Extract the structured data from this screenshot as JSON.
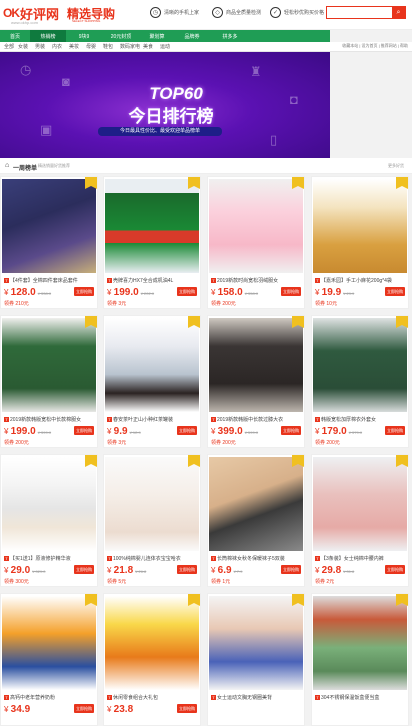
{
  "header": {
    "logo_ok": "OK",
    "logo_text": "好评网",
    "logo_sub": "www.okhp.com",
    "slogan": "精选导购",
    "slogan_sub": "SELECT SHOPPING",
    "features": [
      {
        "icon": "clock-icon",
        "label": "清晰的手机上家"
      },
      {
        "icon": "shield-icon",
        "label": "商品全质量检测"
      },
      {
        "icon": "check-icon",
        "label": "轻松秒优购买价格"
      }
    ],
    "search_placeholder": "",
    "search_icon": "search-icon"
  },
  "nav": {
    "items": [
      "首页",
      "热销榜",
      "9块9",
      "20元封顶",
      "聚划算",
      "品牌券",
      "拼多多"
    ]
  },
  "categories": {
    "items": [
      "全部",
      "女装",
      "男装",
      "内衣",
      "美妆",
      "母婴",
      "鞋包",
      "数码家电",
      "美食",
      "运动"
    ],
    "right_links": "收藏本站 | 设为首页 | 推荐网站 | 帮助"
  },
  "banner": {
    "title": "TOP60",
    "main": "今日排行榜",
    "sub": "今日最具性价比、最受欢迎单品榜单"
  },
  "section": {
    "title": "一周榜单",
    "sub": "精选销量好货推荐",
    "more": "更多好货"
  },
  "products": [
    {
      "name": "【4件套】全棉四件套床品套件",
      "price": "128.0",
      "orig": "¥ 338.0",
      "coupon": "领券 210元"
    },
    {
      "name": "壳牌喜力HX7全合成机油4L",
      "price": "199.0",
      "orig": "¥ 202.0",
      "coupon": "领券 3元"
    },
    {
      "name": "2019新款时尚宽松羽绒服女",
      "price": "158.0",
      "orig": "¥ 358.0",
      "coupon": "领券 200元"
    },
    {
      "name": "【嘉禾园】手工小麻花200g*4袋",
      "price": "19.9",
      "orig": "¥ 29.9",
      "coupon": "领券 10元"
    },
    {
      "name": "2019新款韩版宽松中长款棉服女",
      "price": "199.0",
      "orig": "¥ 399.0",
      "coupon": "领券 200元"
    },
    {
      "name": "春安茶叶正山小种红茶罐装",
      "price": "9.9",
      "orig": "¥ 12.9",
      "coupon": "领券 3元"
    },
    {
      "name": "2019新款韩版中长款过膝大衣",
      "price": "399.0",
      "orig": "¥ 599.0",
      "coupon": "领券 200元"
    },
    {
      "name": "韩版宽松加厚棉衣外套女",
      "price": "179.0",
      "orig": "¥ 379.0",
      "coupon": "领券 200元"
    },
    {
      "name": "【买1送1】原液修护精华液",
      "price": "29.0",
      "orig": "¥ 329.0",
      "coupon": "领券 300元"
    },
    {
      "name": "100%纯棉婴儿连体衣宝宝哈衣",
      "price": "21.8",
      "orig": "¥ 26.8",
      "coupon": "领券 5元"
    },
    {
      "name": "长筒棉袜女秋冬保暖袜子5双装",
      "price": "6.9",
      "orig": "¥ 7.9",
      "coupon": "领券 1元"
    },
    {
      "name": "【3条装】女士纯棉中腰内裤",
      "price": "29.8",
      "orig": "¥ 31.8",
      "coupon": "领券 2元"
    },
    {
      "name": "高钙中老年营养奶粉",
      "price": "34.9",
      "orig": "",
      "coupon": ""
    },
    {
      "name": "休闲零食组合大礼包",
      "price": "23.8",
      "orig": "",
      "coupon": ""
    },
    {
      "name": "女士运动文胸无钢圈美背",
      "price": "",
      "orig": "",
      "coupon": ""
    },
    {
      "name": "304不锈钢保温饭盒便当盒",
      "price": "",
      "orig": "",
      "coupon": ""
    }
  ],
  "buy_label": "立即抢购",
  "colors": {
    "brand": "#e8341c",
    "nav": "#1f9d55",
    "nav_active": "#0f7a3e",
    "banner": "#5b11b3"
  }
}
